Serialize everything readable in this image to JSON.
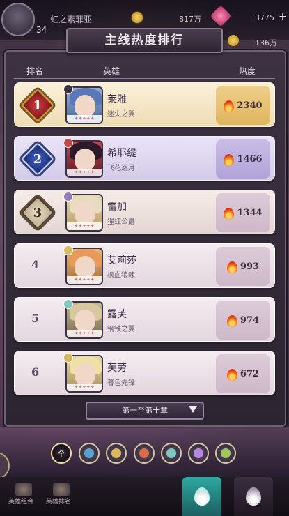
{
  "topbar": {
    "level": "34",
    "player_name": "虹之素菲亚",
    "coins": "817万",
    "gems": "3775",
    "gem_plus": "+",
    "secondary_coins": "136万"
  },
  "panel": {
    "title": "主线热度排行",
    "columns": {
      "rank": "排名",
      "hero": "英雄",
      "heat": "热度"
    }
  },
  "rows": [
    {
      "rank": "1",
      "name": "莱雅",
      "title": "迷失之翼",
      "heat": "2340",
      "stars": "✦✦✦✦✦"
    },
    {
      "rank": "2",
      "name": "希耶缇",
      "title": "飞花逐月",
      "heat": "1466",
      "stars": "✦✦✦✦✦"
    },
    {
      "rank": "3",
      "name": "雷加",
      "title": "猩红公爵",
      "heat": "1344",
      "stars": "✦✦✦✦✦"
    },
    {
      "rank": "4",
      "name": "艾莉莎",
      "title": "枫血狼魂",
      "heat": "993",
      "stars": "✦✦✦✦✦"
    },
    {
      "rank": "5",
      "name": "露芙",
      "title": "钢铁之翼",
      "heat": "974",
      "stars": "✦✦✦✦✦"
    },
    {
      "rank": "6",
      "name": "芙劳",
      "title": "暮色先锋",
      "heat": "672",
      "stars": "✦✦✦✦✦"
    }
  ],
  "chapter_select": {
    "label": "第一至第十章"
  },
  "filters": {
    "all_label": "全",
    "icons": [
      "shield-icon",
      "sword-icon",
      "bow-icon",
      "claw-icon",
      "staff-icon",
      "leaf-icon"
    ],
    "colors": [
      "#5aa0c8",
      "#d8b85a",
      "#d96a4a",
      "#7fc8c0",
      "#b48ad8",
      "#9cc85a"
    ]
  },
  "bottom_nav": {
    "items": [
      {
        "label": "英雄组合"
      },
      {
        "label": "英雄排名"
      }
    ]
  }
}
